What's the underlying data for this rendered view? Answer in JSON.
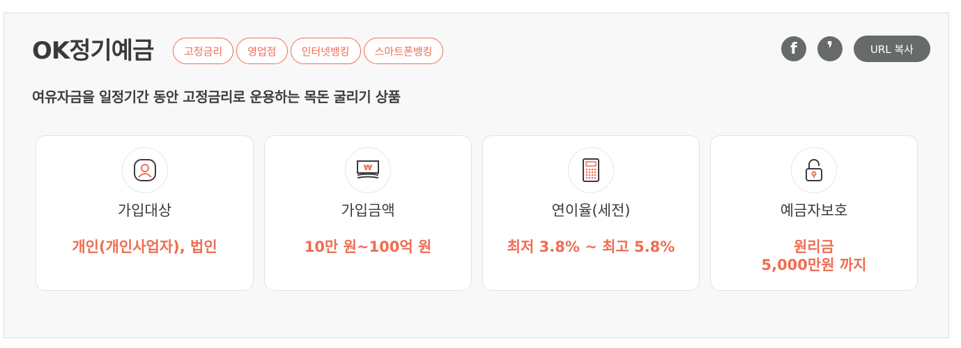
{
  "product": {
    "name": "OK정기예금",
    "tags": [
      "고정금리",
      "영업점",
      "인터넷뱅킹",
      "스마트폰뱅킹"
    ],
    "description": "여유자금을 일정기간 동안 고정금리로 운용하는 목돈 굴리기 상품"
  },
  "share": {
    "facebook_icon_text": "f",
    "kakao_icon_text": "❜",
    "url_copy_label": "URL 복사"
  },
  "cards": [
    {
      "icon": "person-icon",
      "label": "가입대상",
      "value": "개인(개인사업자), 법인"
    },
    {
      "icon": "money-icon",
      "label": "가입금액",
      "value": "10만 원~100억 원"
    },
    {
      "icon": "calculator-icon",
      "label": "연이율(세전)",
      "value": "최저 3.8% ~ 최고 5.8%"
    },
    {
      "icon": "lock-icon",
      "label": "예금자보호",
      "value": "원리금",
      "value2": "5,000만원 까지"
    }
  ],
  "colors": {
    "accent": "#ee6d52",
    "dark": "#3a3a3a",
    "button_gray": "#666a6b"
  }
}
